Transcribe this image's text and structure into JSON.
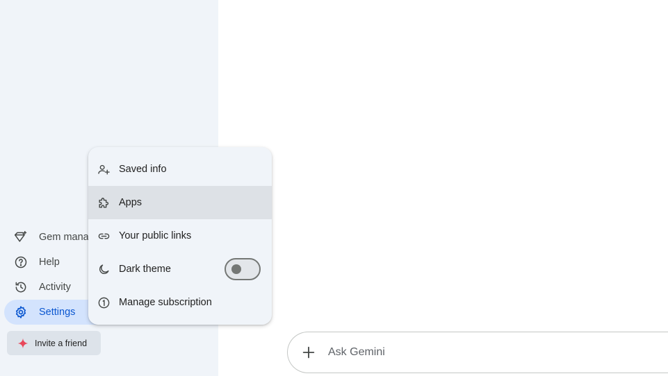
{
  "sidebar": {
    "items": [
      {
        "label": "Gem manager",
        "icon": "gem-icon"
      },
      {
        "label": "Help",
        "icon": "help-icon"
      },
      {
        "label": "Activity",
        "icon": "history-icon"
      },
      {
        "label": "Settings",
        "icon": "gear-icon"
      }
    ],
    "invite_label": "Invite a friend"
  },
  "menu": {
    "items": [
      {
        "label": "Saved info",
        "icon": "person-add-icon"
      },
      {
        "label": "Apps",
        "icon": "puzzle-icon"
      },
      {
        "label": "Your public links",
        "icon": "link-icon"
      },
      {
        "label": "Dark theme",
        "icon": "moon-icon",
        "toggle": false
      },
      {
        "label": "Manage subscription",
        "icon": "subscription-icon"
      }
    ]
  },
  "prompt": {
    "placeholder": "Ask Gemini"
  },
  "colors": {
    "sidebar_bg": "#f0f4f9",
    "active_bg": "#d3e3fd",
    "accent": "#0b57d0",
    "sparkle": "#e8475a"
  }
}
